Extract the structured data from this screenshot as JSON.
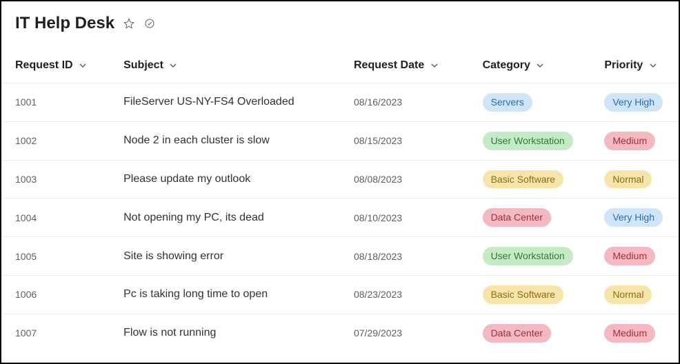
{
  "header": {
    "title": "IT Help Desk"
  },
  "columns": {
    "id": "Request ID",
    "subject": "Subject",
    "date": "Request Date",
    "category": "Category",
    "priority": "Priority"
  },
  "categoryStyles": {
    "Servers": "cat-servers",
    "User Workstation": "cat-userws",
    "Basic Software": "cat-basic",
    "Data Center": "cat-datacenter"
  },
  "priorityStyles": {
    "Very High": "pri-veryhigh",
    "Medium": "pri-medium",
    "Normal": "pri-normal"
  },
  "rows": [
    {
      "id": "1001",
      "subject": "FileServer US-NY-FS4 Overloaded",
      "date": "08/16/2023",
      "category": "Servers",
      "priority": "Very High"
    },
    {
      "id": "1002",
      "subject": "Node 2 in each cluster is slow",
      "date": "08/15/2023",
      "category": "User Workstation",
      "priority": "Medium"
    },
    {
      "id": "1003",
      "subject": "Please update my outlook",
      "date": "08/08/2023",
      "category": "Basic Software",
      "priority": "Normal"
    },
    {
      "id": "1004",
      "subject": "Not opening my PC, its dead",
      "date": "08/10/2023",
      "category": "Data Center",
      "priority": "Very High"
    },
    {
      "id": "1005",
      "subject": "Site is showing error",
      "date": "08/18/2023",
      "category": "User Workstation",
      "priority": "Medium"
    },
    {
      "id": "1006",
      "subject": "Pc is taking long time to open",
      "date": "08/23/2023",
      "category": "Basic Software",
      "priority": "Normal"
    },
    {
      "id": "1007",
      "subject": "Flow is not running",
      "date": "07/29/2023",
      "category": "Data Center",
      "priority": "Medium"
    }
  ]
}
